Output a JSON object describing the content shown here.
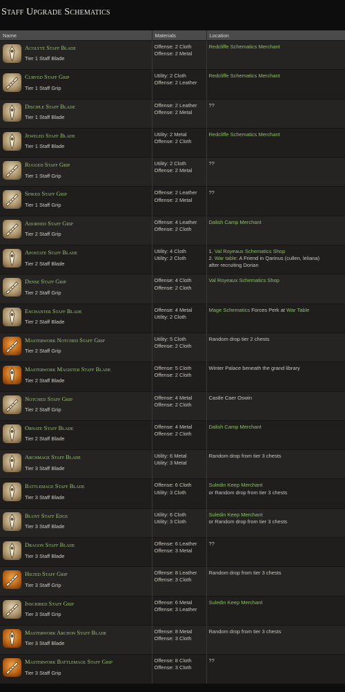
{
  "page": {
    "title": "Staff Upgrade Schematics"
  },
  "table": {
    "headers": {
      "name": "Name",
      "materials": "Materials",
      "location": "Location"
    },
    "rows": [
      {
        "name": "Acolyte Staff Blade",
        "tier": "Tier 1 Staff Blade",
        "icon": "blade-icon",
        "rarity": "common",
        "materials": [
          "Offense: 2 Cloth",
          "Offense: 2 Metal"
        ],
        "location": [
          [
            {
              "t": "Redcliffe Schematics Merchant",
              "c": "green"
            }
          ]
        ]
      },
      {
        "name": "Curved Staff Grip",
        "tier": "Tier 1 Staff Grip",
        "icon": "grip-icon",
        "rarity": "common",
        "materials": [
          "Utility: 2 Cloth",
          "Offense: 2 Leather"
        ],
        "location": [
          [
            {
              "t": "Redcliffe Schematics Merchant",
              "c": "green"
            }
          ]
        ]
      },
      {
        "name": "Disciple Staff Blade",
        "tier": "Tier 1 Staff Blade",
        "icon": "blade-icon",
        "rarity": "common",
        "materials": [
          "Offense: 2 Leather",
          "Offense: 2 Metal"
        ],
        "location": [
          [
            {
              "t": "??",
              "c": "plain"
            }
          ]
        ]
      },
      {
        "name": "Jeweled Staff Blade",
        "tier": "Tier 1 Staff Blade",
        "icon": "blade-icon",
        "rarity": "common",
        "materials": [
          "Utility: 2 Metal",
          "Offense: 2 Cloth"
        ],
        "location": [
          [
            {
              "t": "Redcliffe Schematics Merchant",
              "c": "green"
            }
          ]
        ]
      },
      {
        "name": "Rugged Staff Grip",
        "tier": "Tier 1 Staff Grip",
        "icon": "grip-icon",
        "rarity": "common",
        "materials": [
          "Utility: 2 Cloth",
          "Offense: 2 Metal"
        ],
        "location": [
          [
            {
              "t": "??",
              "c": "plain"
            }
          ]
        ]
      },
      {
        "name": "Spiked Staff Grip",
        "tier": "Tier 1 Staff Grip",
        "icon": "grip-icon",
        "rarity": "common",
        "materials": [
          "Offense: 2 Leather",
          "Offense: 2 Metal"
        ],
        "location": [
          [
            {
              "t": "??",
              "c": "plain"
            }
          ]
        ]
      },
      {
        "name": "Adorned Staff Grip",
        "tier": "Tier 2 Staff Grip",
        "icon": "grip-icon",
        "rarity": "common",
        "materials": [
          "Offense: 4 Leather",
          "Offense: 2 Cloth"
        ],
        "location": [
          [
            {
              "t": "Dalish Camp Merchant",
              "c": "green"
            }
          ]
        ]
      },
      {
        "name": "Apostate Staff Blade",
        "tier": "Tier 2 Staff Blade",
        "icon": "blade-icon",
        "rarity": "common",
        "materials": [
          "Utility: 4 Cloth",
          "Utility: 2 Cloth"
        ],
        "location": [
          [
            {
              "t": "1. ",
              "c": "plain"
            },
            {
              "t": "Val Royeaux Schematics Shop",
              "c": "green"
            }
          ],
          [
            {
              "t": "2. ",
              "c": "plain"
            },
            {
              "t": "War table",
              "c": "green"
            },
            {
              "t": ": A Friend in Qarinus (cullen, leliana)",
              "c": "plain"
            }
          ],
          [
            {
              "t": "after recruiting Dorian",
              "c": "plain"
            }
          ]
        ]
      },
      {
        "name": "Dense Staff Grip",
        "tier": "Tier 2 Staff Grip",
        "icon": "grip-icon",
        "rarity": "common",
        "materials": [
          "Offense: 4 Cloth",
          "Offense: 2 Cloth"
        ],
        "location": [
          [
            {
              "t": "Val Royeaux Schematics Shop",
              "c": "green"
            }
          ]
        ]
      },
      {
        "name": "Enchanter Staff Blade",
        "tier": "Tier 2 Staff Blade",
        "icon": "blade-icon",
        "rarity": "common",
        "materials": [
          "Offense: 4 Metal",
          "Utility: 2 Cloth"
        ],
        "location": [
          [
            {
              "t": "Mage Schematics",
              "c": "green"
            },
            {
              "t": " Forces Perk at ",
              "c": "plain"
            },
            {
              "t": "War Table",
              "c": "green"
            }
          ]
        ]
      },
      {
        "name": "Masterwork Notched Staff Grip",
        "tier": "Tier 2 Staff Grip",
        "icon": "grip-icon",
        "rarity": "master",
        "materials": [
          "Utility: 5 Cloth",
          "Offense: 2 Cloth"
        ],
        "location": [
          [
            {
              "t": "Random drop tier 2 chests",
              "c": "plain"
            }
          ]
        ]
      },
      {
        "name": "Masterwork Magister Staff Blade",
        "tier": "Tier 2 Staff Blade",
        "icon": "blade-icon",
        "rarity": "master",
        "materials": [
          "Offense: 5 Cloth",
          "Offense: 2 Cloth"
        ],
        "location": [
          [
            {
              "t": "Winter Palace beneath the grand library",
              "c": "plain"
            }
          ]
        ]
      },
      {
        "name": "Notched Staff Grip",
        "tier": "Tier 2 Staff Grip",
        "icon": "grip-icon",
        "rarity": "common",
        "materials": [
          "Offense: 4 Metal",
          "Offense: 2 Cloth"
        ],
        "location": [
          [
            {
              "t": "Castle Caer Oswin",
              "c": "plain"
            }
          ]
        ]
      },
      {
        "name": "Ornate Staff Blade",
        "tier": "Tier 2 Staff Blade",
        "icon": "blade-icon",
        "rarity": "common",
        "materials": [
          "Offense: 4 Metal",
          "Offense: 2 Cloth"
        ],
        "location": [
          [
            {
              "t": "Dalish Camp Merchant",
              "c": "green"
            }
          ]
        ]
      },
      {
        "name": "Archmage Staff Blade",
        "tier": "Tier 3 Staff Blade",
        "icon": "blade-icon",
        "rarity": "common",
        "materials": [
          "Utility: 6 Metal",
          "Utility: 3 Metal"
        ],
        "location": [
          [
            {
              "t": "Random drop from tier 3 chests",
              "c": "plain"
            }
          ]
        ]
      },
      {
        "name": "Battlemage Staff Blade",
        "tier": "Tier 3 Staff Blade",
        "icon": "blade-icon",
        "rarity": "common",
        "materials": [
          "Offense: 6 Cloth",
          "Utility: 3 Cloth"
        ],
        "location": [
          [
            {
              "t": "Suledin Keep Merchant",
              "c": "green"
            }
          ],
          [
            {
              "t": "or Random drop from tier 3 chests",
              "c": "plain"
            }
          ]
        ]
      },
      {
        "name": "Blunt Staff Edge",
        "tier": "Tier 3 Staff Blade",
        "icon": "blade-icon",
        "rarity": "common",
        "materials": [
          "Utility: 6 Cloth",
          "Utility: 3 Cloth"
        ],
        "location": [
          [
            {
              "t": "Suledin Keep Merchant",
              "c": "green"
            }
          ],
          [
            {
              "t": "or Random drop from tier 3 chests",
              "c": "plain"
            }
          ]
        ]
      },
      {
        "name": "Dragon Staff Blade",
        "tier": "Tier 3 Staff Blade",
        "icon": "blade-icon",
        "rarity": "common",
        "materials": [
          "Offense: 6 Leather",
          "Offense: 3 Metal"
        ],
        "location": [
          [
            {
              "t": "??",
              "c": "plain"
            }
          ]
        ]
      },
      {
        "name": "Hilted Staff Grip",
        "tier": "Tier 3 Staff Grip",
        "icon": "grip-icon",
        "rarity": "master",
        "materials": [
          "Offense: 8 Leather",
          "Offense: 3 Cloth"
        ],
        "location": [
          [
            {
              "t": "Random drop from tier 3 chests",
              "c": "plain"
            }
          ]
        ]
      },
      {
        "name": "Inscribed Staff Grip",
        "tier": "Tier 3 Staff Grip",
        "icon": "grip-icon",
        "rarity": "common",
        "materials": [
          "Offense: 6 Metal",
          "Offense: 3 Leather"
        ],
        "location": [
          [
            {
              "t": "Suledin Keep Merchant",
              "c": "green"
            }
          ]
        ]
      },
      {
        "name": "Masterwork Archon Staff Blade",
        "tier": "Tier 3 Staff Blade",
        "icon": "blade-icon",
        "rarity": "master",
        "materials": [
          "Offense: 8 Metal",
          "Offense: 3 Cloth"
        ],
        "location": [
          [
            {
              "t": "Random drop from tier 3 chests",
              "c": "plain"
            }
          ]
        ]
      },
      {
        "name": "Masterwork Battlemage Staff Grip",
        "tier": "Tier 3 Staff Grip",
        "icon": "grip-icon",
        "rarity": "master",
        "materials": [
          "Offense: 8 Cloth",
          "Offense: 3 Cloth"
        ],
        "location": [
          [
            {
              "t": "??",
              "c": "plain"
            }
          ]
        ]
      }
    ]
  }
}
